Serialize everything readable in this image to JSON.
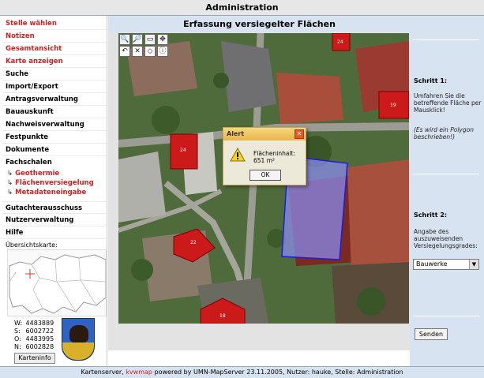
{
  "app": {
    "title": "Administration"
  },
  "sidebar": {
    "items": [
      {
        "label": "Stelle wählen",
        "style": "red"
      },
      {
        "label": "Notizen",
        "style": "red"
      },
      {
        "label": "Gesamtansicht",
        "style": "red"
      },
      {
        "label": "Karte anzeigen",
        "style": "red"
      },
      {
        "label": "Suche",
        "style": "black"
      },
      {
        "label": "Import/Export",
        "style": "black"
      },
      {
        "label": "Antragsverwaltung",
        "style": "black"
      },
      {
        "label": "Bauauskunft",
        "style": "black"
      },
      {
        "label": "Nachweisverwaltung",
        "style": "black"
      },
      {
        "label": "Festpunkte",
        "style": "black"
      },
      {
        "label": "Dokumente",
        "style": "black"
      },
      {
        "label": "Fachschalen",
        "style": "black"
      }
    ],
    "subitems": [
      {
        "label": "Geothermie"
      },
      {
        "label": "Flächenversiegelung"
      },
      {
        "label": "Metadateneingabe"
      }
    ],
    "bottom_items": [
      {
        "label": "Gutachterausschuss"
      },
      {
        "label": "Nutzerverwaltung"
      },
      {
        "label": "Hilfe"
      }
    ],
    "overview_label": "Übersichtskarte:",
    "coords": {
      "w": "4483889",
      "s": "6002722",
      "o": "4483995",
      "n": "6002828"
    },
    "coord_labels": {
      "w": "W:",
      "s": "S:",
      "o": "O:",
      "n": "N:"
    },
    "karteninfo_label": "Karteninfo"
  },
  "main": {
    "title": "Erfassung versiegelter Flächen",
    "toolbar": [
      {
        "icon": "zoom-in-icon",
        "glyph": "🔍"
      },
      {
        "icon": "zoom-out-icon",
        "glyph": "🔎"
      },
      {
        "icon": "zoom-extent-icon",
        "glyph": "▭"
      },
      {
        "icon": "pan-icon",
        "glyph": "✥"
      },
      {
        "icon": "undo-icon",
        "glyph": "↶"
      },
      {
        "icon": "delete-icon",
        "glyph": "✕"
      },
      {
        "icon": "polygon-icon",
        "glyph": "◇"
      },
      {
        "icon": "info-icon",
        "glyph": "ⓘ"
      }
    ],
    "buildings": [
      "24",
      "24",
      "22",
      "18",
      "19"
    ]
  },
  "right_panel": {
    "step1_title": "Schritt 1:",
    "step1_text": "Umfahren Sie die betreffende Fläche per Mausklick!",
    "step1_hint": "(Es wird ein Polygon beschrieben!)",
    "step2_title": "Schritt 2:",
    "step2_text": "Angabe des auszuweisenden Versiegelungsgrades:",
    "select_value": "Bauwerke",
    "send_label": "Senden"
  },
  "alert": {
    "title": "Alert",
    "message": "Flächeninhalt: 651 m²",
    "ok_label": "OK"
  },
  "footer": {
    "prefix": "Kartenserver, ",
    "link": "kvwmap",
    "suffix": " powered by UMN-MapServer 23.11.2005, Nutzer: hauke, Stelle: Administration"
  },
  "colors": {
    "accent_red": "#cc2222",
    "panel_blue": "#d8e3f1",
    "polygon": "#8a8aee"
  }
}
